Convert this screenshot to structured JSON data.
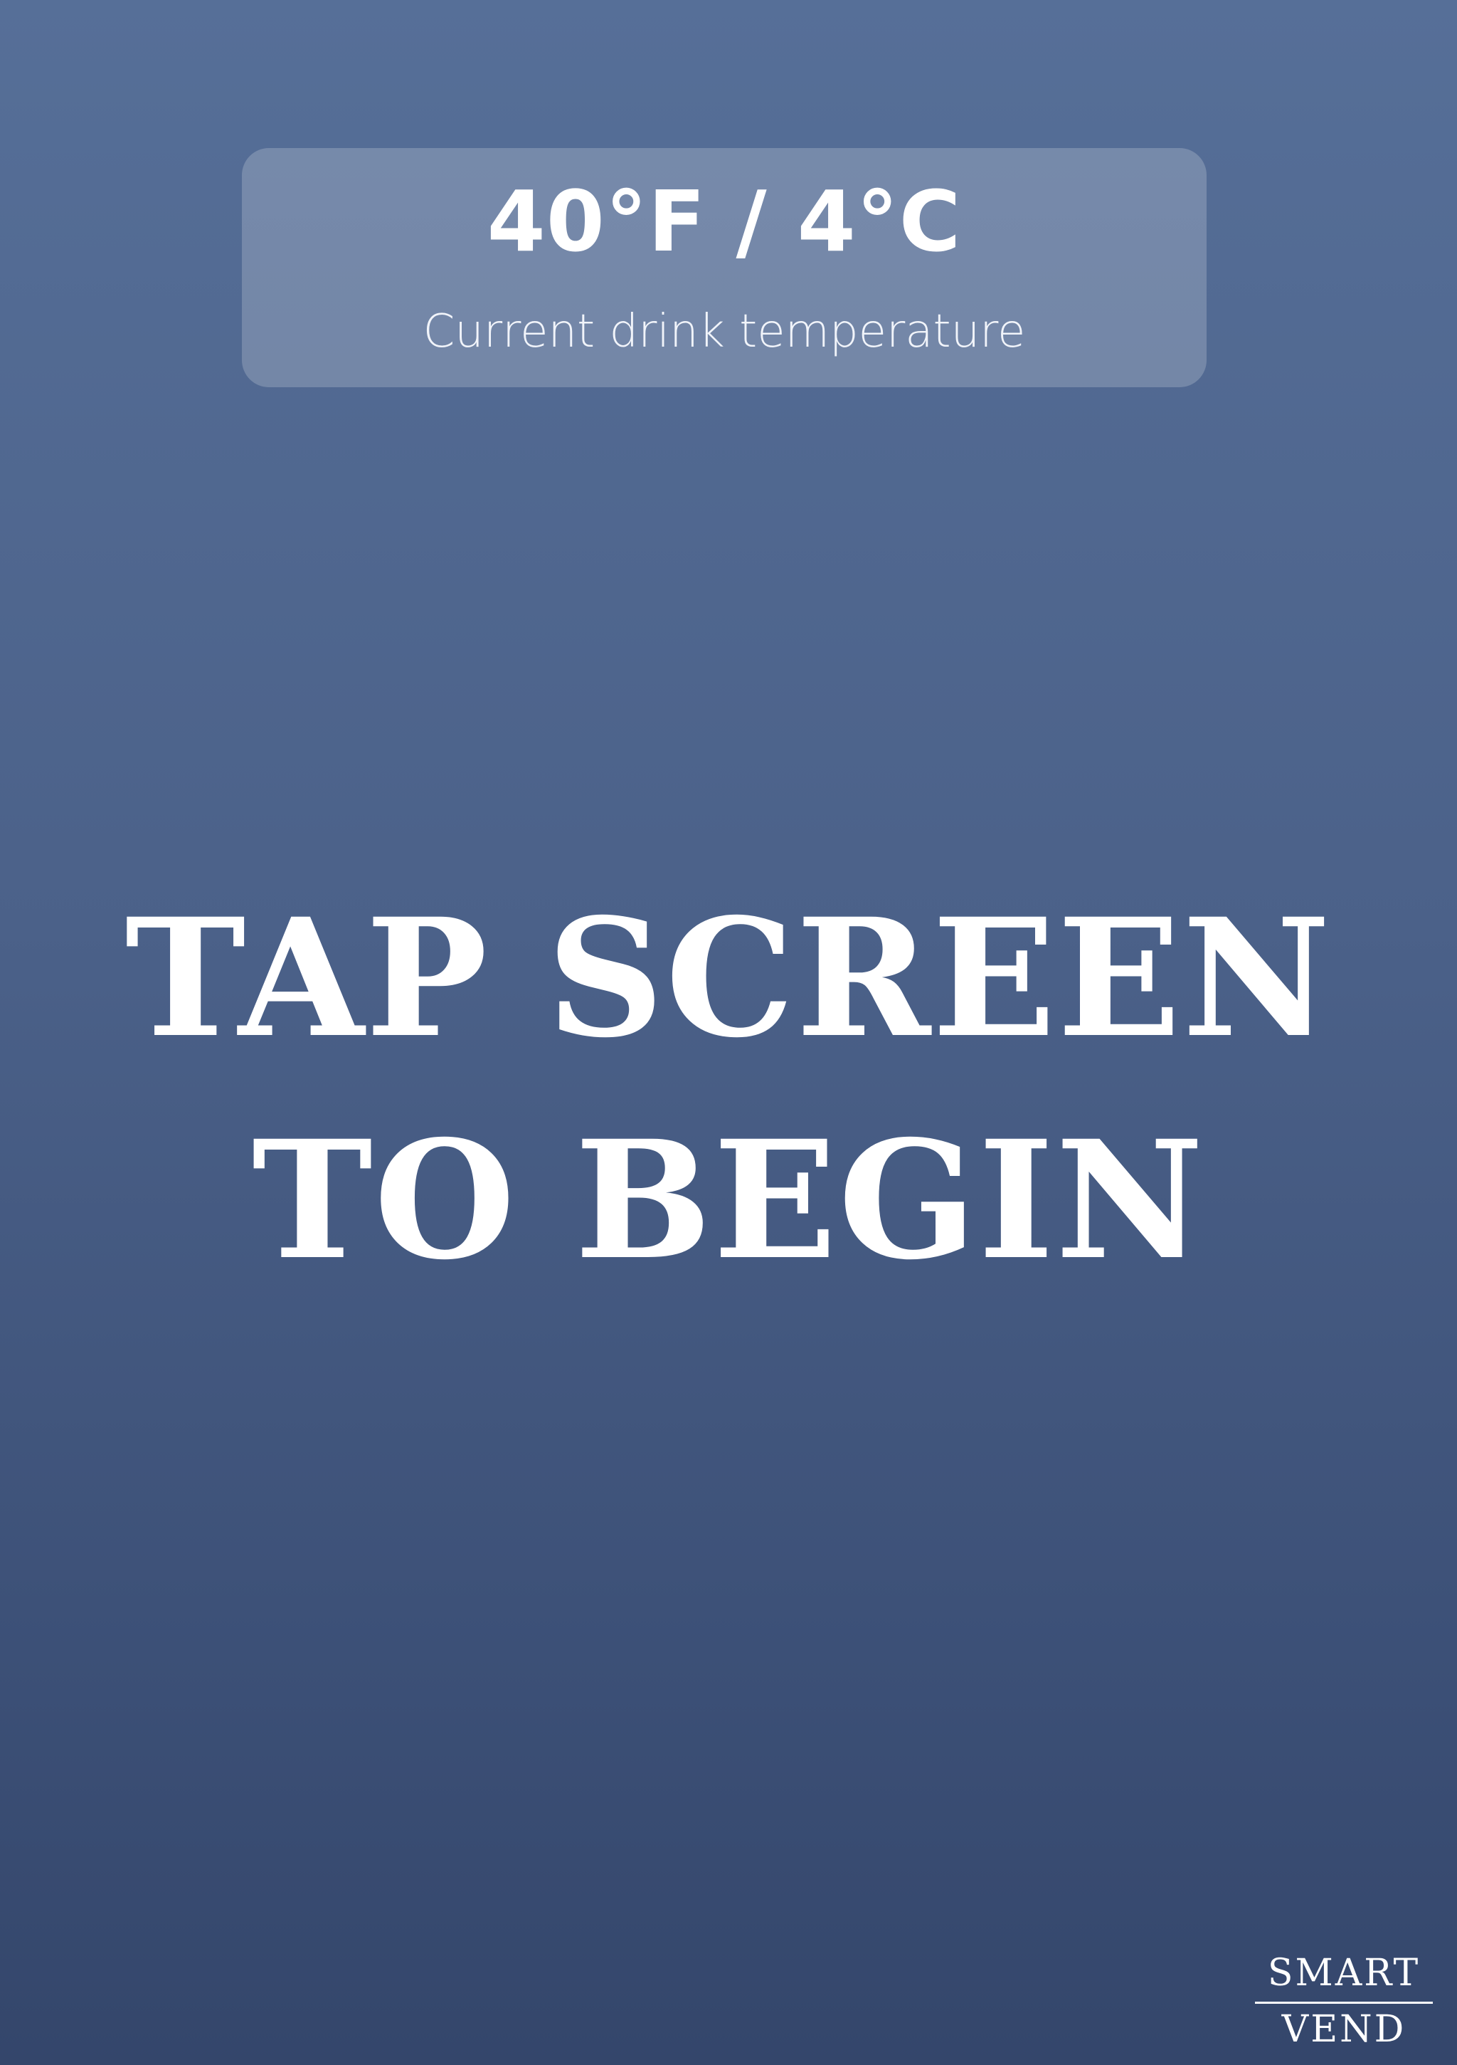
{
  "temperature": {
    "value": "40°F / 4°C",
    "caption": "Current drink temperature"
  },
  "prompt": {
    "line1": "TAP SCREEN",
    "line2": "TO BEGIN"
  },
  "brand": {
    "line1": "SMART",
    "line2": "VEND"
  },
  "colors": {
    "background_top": "#566f98",
    "background_bottom": "#34466b",
    "text": "#ffffff"
  }
}
